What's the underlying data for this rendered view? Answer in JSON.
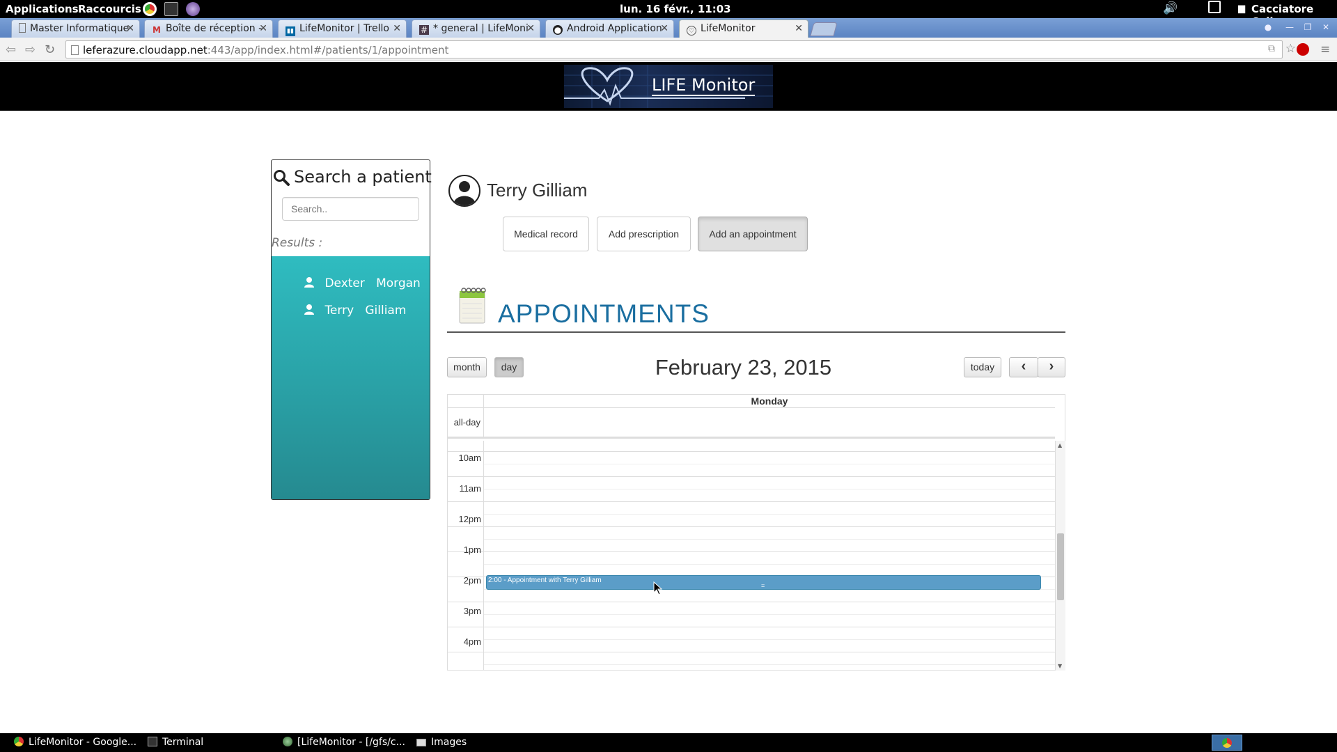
{
  "top_panel": {
    "applications": "Applications",
    "shortcuts": "Raccourcis",
    "clock": "lun. 16 févr., 11:03",
    "user": "Cacciatore Celia"
  },
  "tabs": [
    {
      "label": "Master Informatique"
    },
    {
      "label": "Boîte de réception -"
    },
    {
      "label": "LifeMonitor | Trello"
    },
    {
      "label": "* general | LifeMoni"
    },
    {
      "label": "Android Application"
    },
    {
      "label": "LifeMonitor"
    }
  ],
  "address_bar": {
    "host": "leferazure.cloudapp.net",
    "rest": ":443/app/index.html#/patients/1/appointment"
  },
  "site": {
    "logo_text": "LIFE Monitor"
  },
  "sidebar": {
    "title": "Search a patient",
    "search_placeholder": "Search..",
    "results_label": "Results :",
    "results": [
      {
        "first": "Dexter",
        "last": "Morgan"
      },
      {
        "first": "Terry",
        "last": "Gilliam"
      }
    ]
  },
  "patient": {
    "name": "Terry Gilliam",
    "buttons": {
      "medical_record": "Medical record",
      "add_prescription": "Add prescription",
      "add_appointment": "Add an appointment"
    }
  },
  "appointments": {
    "title": "APPOINTMENTS",
    "view_month": "month",
    "view_day": "day",
    "date_title": "February 23, 2015",
    "today": "today",
    "prev": "‹",
    "next": "›",
    "day_name": "Monday",
    "allday_label": "all-day",
    "hours": [
      "10am",
      "11am",
      "12pm",
      "1pm",
      "2pm",
      "3pm",
      "4pm"
    ],
    "event": {
      "text": "2:00 - Appointment with Terry Gilliam",
      "resizer": "="
    },
    "event_color": "#5b9dc8"
  },
  "taskbar": [
    {
      "label": "LifeMonitor - Google..."
    },
    {
      "label": "Terminal"
    },
    {
      "label": "[LifeMonitor - [/gfs/c..."
    },
    {
      "label": "Images"
    }
  ],
  "colors": {
    "results_panel": "#2fbcc0",
    "title_blue": "#1a6ea0"
  }
}
